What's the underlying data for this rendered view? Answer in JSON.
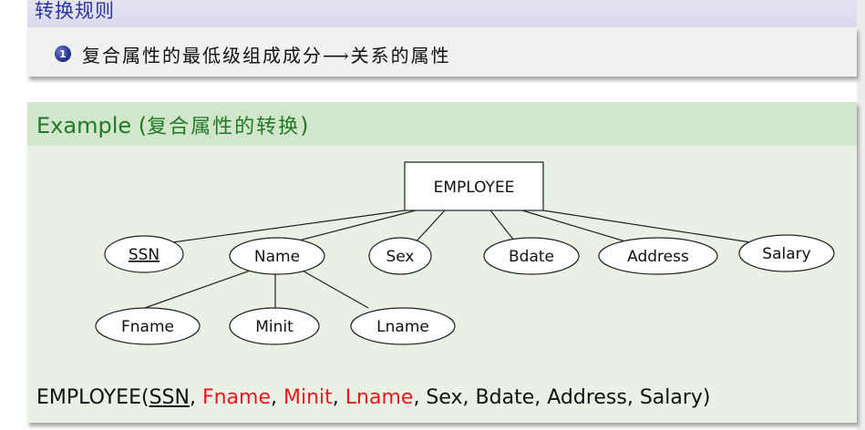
{
  "rule": {
    "title": "转换规则",
    "bullet_number": "1",
    "text": "复合属性的最低级组成成分⟶关系的属性"
  },
  "example": {
    "title_prefix": "Example (",
    "title_cn": "复合属性的转换",
    "title_suffix": ")"
  },
  "diagram": {
    "entity": "EMPLOYEE",
    "attributes": {
      "ssn": "SSN",
      "name": "Name",
      "sex": "Sex",
      "bdate": "Bdate",
      "address": "Address",
      "salary": "Salary",
      "fname": "Fname",
      "minit": "Minit",
      "lname": "Lname"
    }
  },
  "relation": {
    "name": "EMPLOYEE(",
    "key": "SSN",
    "sep1": ", ",
    "fname": "Fname",
    "sep2": ", ",
    "minit": "Minit",
    "sep3": ", ",
    "lname": "Lname",
    "rest": ", Sex, Bdate, Address, Salary)"
  },
  "colors": {
    "rule_title": "#2d36a0",
    "example_title": "#1f7a26",
    "highlight": "#e21a1a",
    "example_header_bg": "#d2e6cb",
    "example_body_bg": "#e8f1e4"
  }
}
